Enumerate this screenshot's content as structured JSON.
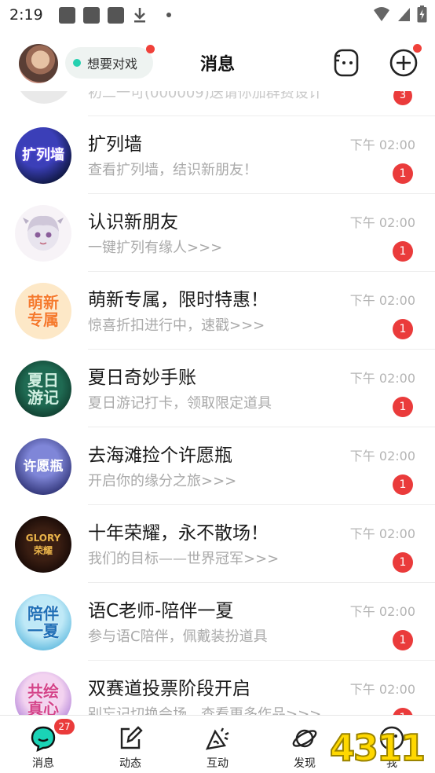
{
  "status_bar": {
    "time": "2:19",
    "battery_icon": "battery-charging-icon",
    "signal_icon": "cell-signal-icon",
    "wifi_icon": "wifi-icon"
  },
  "header": {
    "title": "消息",
    "status_pill_label": "想要对戏",
    "status_pill_dot_color": "#25d0b0",
    "badge_color": "#f0413a"
  },
  "partial_row": {
    "text": "初二一可(000009)送请你加群费设计",
    "badge": "3"
  },
  "conversations": [
    {
      "name": "扩列墙",
      "preview": "查看扩列墙，结识新朋友！",
      "time": "下午 02:00",
      "badge": "1",
      "avatar_text": "扩列墙"
    },
    {
      "name": "认识新朋友",
      "preview": "一键扩列有缘人>>>",
      "time": "下午 02:00",
      "badge": "1",
      "avatar_text": ""
    },
    {
      "name": "萌新专属，限时特惠！",
      "preview": "惊喜折扣进行中，速戳>>>",
      "time": "下午 02:00",
      "badge": "1",
      "avatar_text": "萌新专属"
    },
    {
      "name": "夏日奇妙手账",
      "preview": "夏日游记打卡，领取限定道具",
      "time": "下午 02:00",
      "badge": "1",
      "avatar_text": "夏日游记"
    },
    {
      "name": "去海滩捡个许愿瓶",
      "preview": "开启你的缘分之旅>>>",
      "time": "下午 02:00",
      "badge": "1",
      "avatar_text": "许愿瓶"
    },
    {
      "name": "十年荣耀，永不散场！",
      "preview": "我们的目标——世界冠军>>>",
      "time": "下午 02:00",
      "badge": "1",
      "avatar_text": "GLORY 荣耀"
    },
    {
      "name": "语C老师-陪伴一夏",
      "preview": "参与语C陪伴，佩戴装扮道具",
      "time": "下午 02:00",
      "badge": "1",
      "avatar_text": "陪伴一夏"
    },
    {
      "name": "双赛道投票阶段开启",
      "preview": "别忘记切换会场，查看更多作品>>>",
      "time": "下午 02:00",
      "badge": "1",
      "avatar_text": "共绘真心"
    }
  ],
  "tabbar": {
    "tabs": [
      {
        "label": "消息",
        "icon": "chat-bubble-icon",
        "badge": "27",
        "active": true
      },
      {
        "label": "动态",
        "icon": "edit-icon"
      },
      {
        "label": "互动",
        "icon": "sparkle-cone-icon"
      },
      {
        "label": "发现",
        "icon": "planet-icon"
      },
      {
        "label": "我",
        "icon": "smiley-icon"
      }
    ],
    "accent_color": "#1ad3b6",
    "watermark": "4311"
  }
}
